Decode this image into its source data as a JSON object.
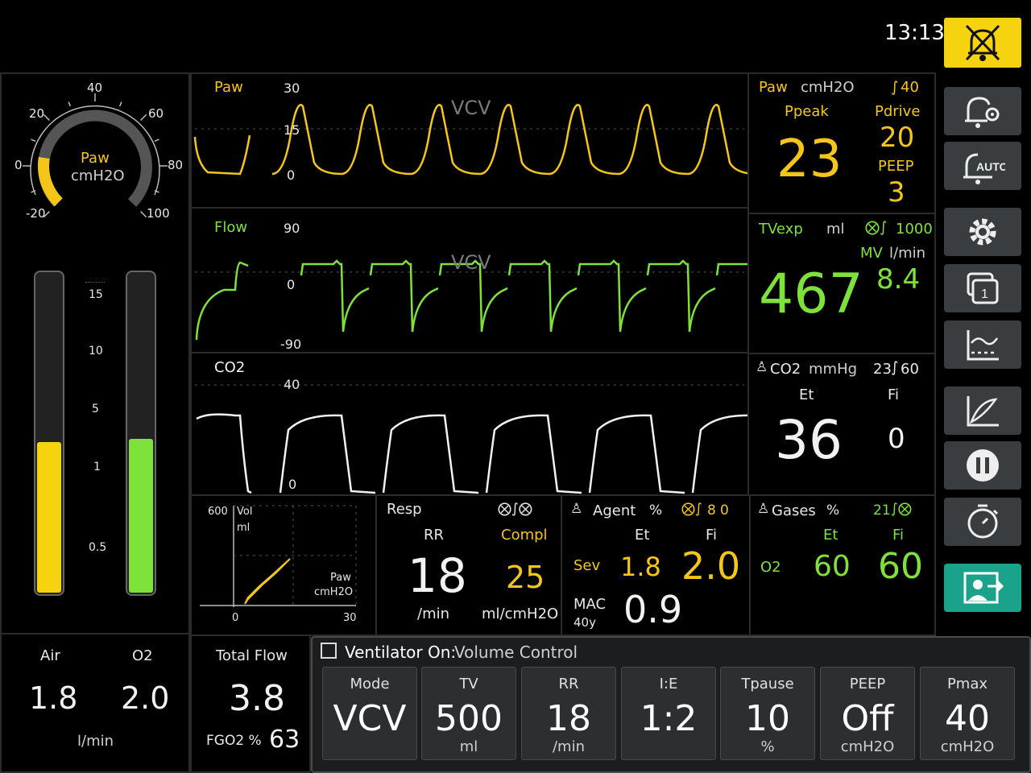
{
  "clock": "13:13",
  "colors": {
    "paw": "#f5c518",
    "flow": "#7ee23a",
    "co2": "#f2f2f2",
    "alarm_button": "#f5d40f",
    "exit_button": "#1aa38a"
  },
  "gauge": {
    "label": "Paw",
    "unit": "cmH2O",
    "ticks": [
      "-20",
      "0",
      "20",
      "40",
      "60",
      "80",
      "100"
    ],
    "value_fraction": 0.2
  },
  "flowmeters": {
    "scale": [
      "15",
      "10",
      "5",
      "1",
      "0.5"
    ],
    "air": {
      "label": "Air",
      "value": "1.8",
      "level_fraction": 0.47
    },
    "o2": {
      "label": "O2",
      "value": "2.0",
      "level_fraction": 0.48
    },
    "unit": "l/min"
  },
  "total_flow": {
    "label": "Total Flow",
    "value": "3.8",
    "fgo2_label": "FGO2 %",
    "fgo2_value": "63"
  },
  "waves": {
    "paw": {
      "label": "Paw",
      "scale_top": "30",
      "scale_mid": "15",
      "scale_zero": "0",
      "mode": "VCV"
    },
    "flow": {
      "label": "Flow",
      "scale_top": "90",
      "scale_zero": "0",
      "scale_bottom": "-90",
      "mode": "VCV"
    },
    "co2": {
      "label": "CO2",
      "scale_top": "40",
      "scale_zero": "0"
    }
  },
  "loop": {
    "y_max": "600",
    "y_label": "Vol",
    "y_unit": "ml",
    "x_min": "0",
    "x_max": "30",
    "x_label": "Paw",
    "x_unit": "cmH2O"
  },
  "paw_panel": {
    "label": "Paw",
    "unit": "cmH2O",
    "limit": "40",
    "ppeak_label": "Ppeak",
    "ppeak": "23",
    "pdrive_label": "Pdrive",
    "pdrive": "20",
    "peep_label": "PEEP",
    "peep": "3"
  },
  "tv_panel": {
    "label": "TVexp",
    "unit": "ml",
    "limit": "1000",
    "mv_label": "MV",
    "mv_unit": "l/min",
    "mv": "8.4",
    "value": "467"
  },
  "co2_panel": {
    "label": "CO2",
    "unit": "mmHg",
    "limits": "23",
    "limit_high": "60",
    "et_label": "Et",
    "fi_label": "Fi",
    "et": "36",
    "fi": "0"
  },
  "resp_panel": {
    "label": "Resp",
    "rr_label": "RR",
    "compl_label": "Compl",
    "rr": "18",
    "compl": "25",
    "rr_unit": "/min",
    "compl_unit": "ml/cmH2O"
  },
  "agent_panel": {
    "label": "Agent",
    "unit": "%",
    "limit": "8",
    "limit2": "0",
    "et_label": "Et",
    "fi_label": "Fi",
    "agent": "Sev",
    "et": "1.8",
    "fi": "2.0",
    "mac_label": "MAC",
    "age": "40y",
    "mac": "0.9"
  },
  "gases_panel": {
    "label": "Gases",
    "unit": "%",
    "limit": "21",
    "et_label": "Et",
    "fi_label": "Fi",
    "gas": "O2",
    "et": "60",
    "fi": "60"
  },
  "ventilator": {
    "title_bold": "Ventilator On:",
    "title_mode": "Volume Control",
    "settings": [
      {
        "title": "Mode",
        "value": "VCV",
        "unit": ""
      },
      {
        "title": "TV",
        "value": "500",
        "unit": "ml"
      },
      {
        "title": "RR",
        "value": "18",
        "unit": "/min"
      },
      {
        "title": "I:E",
        "value": "1:2",
        "unit": ""
      },
      {
        "title": "Tpause",
        "value": "10",
        "unit": "%"
      },
      {
        "title": "PEEP",
        "value": "Off",
        "unit": "cmH2O"
      },
      {
        "title": "Pmax",
        "value": "40",
        "unit": "cmH2O"
      }
    ]
  },
  "side_buttons": {
    "auto_label": "AUTO",
    "page_number": "1"
  },
  "icons": [
    "alarm-silence-icon",
    "alarm-settings-icon",
    "alarm-auto-icon",
    "gear-icon",
    "pages-icon",
    "trends-icon",
    "loops-icon",
    "pause-icon",
    "timer-icon",
    "exit-case-icon"
  ]
}
